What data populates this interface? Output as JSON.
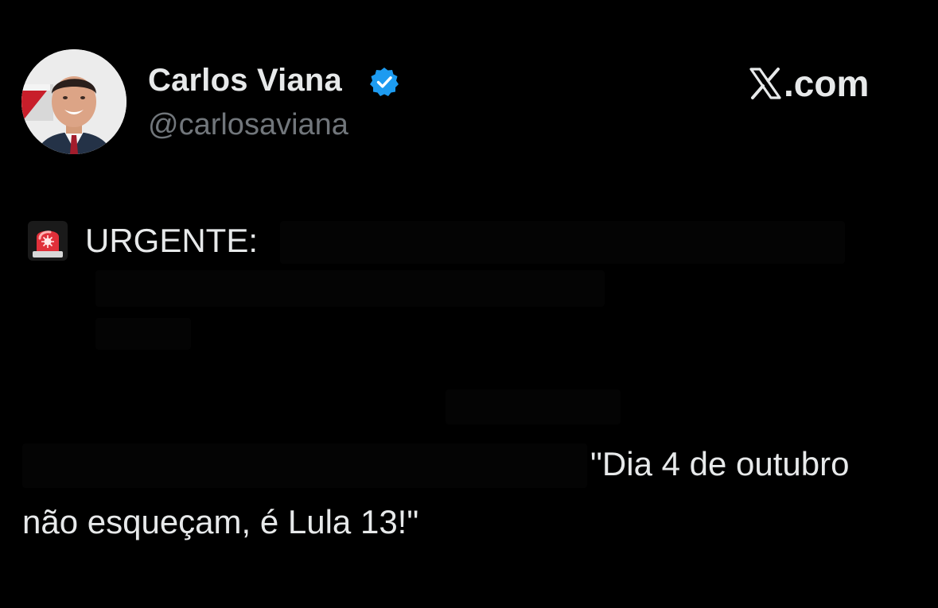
{
  "author": {
    "display_name": "Carlos Viana",
    "handle": "@carlosaviana",
    "verified": true,
    "avatar_icon": "avatar-photo"
  },
  "brand": {
    "logo_icon": "x-logo-icon",
    "domain_suffix": ".com"
  },
  "post": {
    "alert_icon": "siren-icon",
    "label": "URGENTE:",
    "quote_line_1": "\"Dia 4 de outubro",
    "quote_line_2": "não esqueçam, é Lula 13!\""
  },
  "colors": {
    "background": "#000000",
    "text": "#e7e9ea",
    "secondary_text": "#71767b",
    "verified_badge": "#1d9bf0",
    "siren_red": "#e0303a"
  }
}
